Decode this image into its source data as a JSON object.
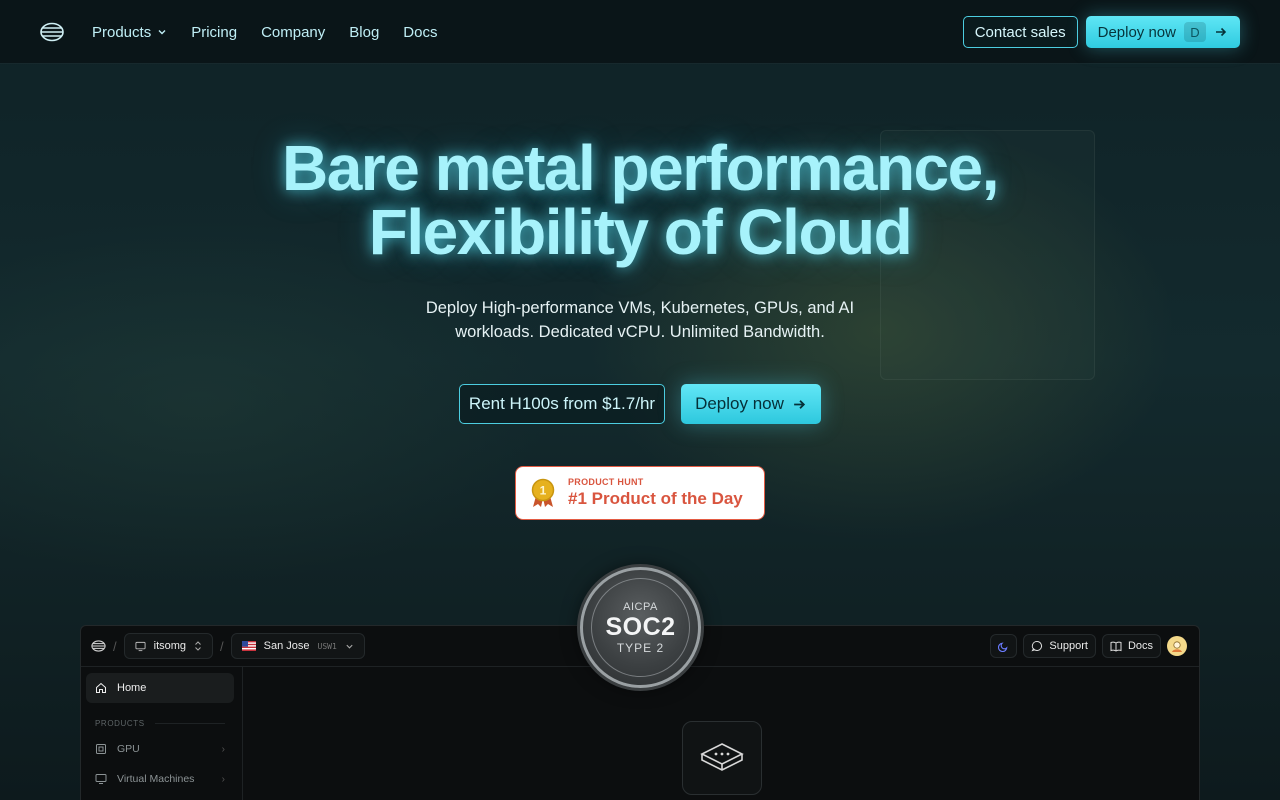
{
  "nav": {
    "logo_icon": "stacked-lines-logo-icon",
    "links": [
      {
        "label": "Products",
        "has_dropdown": true
      },
      {
        "label": "Pricing"
      },
      {
        "label": "Company"
      },
      {
        "label": "Blog"
      },
      {
        "label": "Docs"
      }
    ],
    "contact_label": "Contact sales",
    "deploy_label": "Deploy now",
    "deploy_shortcut": "D"
  },
  "hero": {
    "title_line1": "Bare metal performance,",
    "title_line2": "Flexibility of Cloud",
    "subtitle": "Deploy High-performance VMs, Kubernetes, GPUs, and AI workloads. Dedicated vCPU. Unlimited Bandwidth.",
    "cta_secondary": "Rent H100s from $1.7/hr",
    "cta_primary": "Deploy now"
  },
  "product_hunt": {
    "small": "PRODUCT HUNT",
    "big": "#1 Product of the Day",
    "medal_number": "1"
  },
  "soc2": {
    "line1": "AICPA",
    "line2": "SOC2",
    "line3": "TYPE 2"
  },
  "app_preview": {
    "workspace": "itsomg",
    "region": "San Jose",
    "region_code": "USW1",
    "support_label": "Support",
    "docs_label": "Docs",
    "sidebar": {
      "home": "Home",
      "section": "PRODUCTS",
      "items": [
        {
          "label": "GPU"
        },
        {
          "label": "Virtual Machines"
        }
      ]
    }
  },
  "colors": {
    "accent": "#4ccde0",
    "title_glow": "#a7f2fb",
    "product_hunt": "#d9553f"
  }
}
